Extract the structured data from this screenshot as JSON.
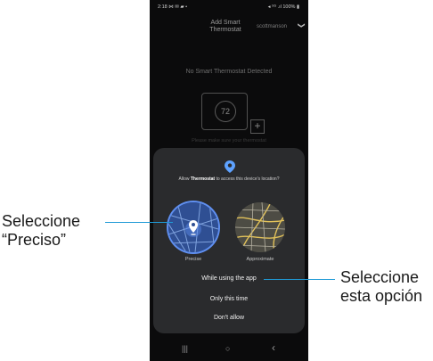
{
  "status_bar": {
    "time": "2:18 ⋈ ✉ ▰ •",
    "right": "◂ ⁵ᴳ .ıl 100% ▮"
  },
  "header": {
    "title": "Add Smart Thermostat",
    "user": "scottmanson",
    "chevron": "❯"
  },
  "main": {
    "no_detect_text": "No Smart Thermostat Detected",
    "thermostat_temp": "72",
    "plus": "+",
    "hint_text": "Please make sure your thermostat"
  },
  "dialog": {
    "prompt_prefix": "Allow ",
    "prompt_app": "Thermostat",
    "prompt_suffix": " to access this device's location?",
    "precise_label": "Precise",
    "approximate_label": "Approximate",
    "options": [
      "While using the app",
      "Only this time",
      "Don't allow"
    ]
  },
  "nav_bar": {
    "recents": "|||",
    "home": "○",
    "back": "‹"
  },
  "callouts": {
    "left_line1": "Seleccione",
    "left_line2": "“Preciso”",
    "right_line1": "Seleccione",
    "right_line2": "esta opción"
  },
  "colors": {
    "accent": "#1f9ad6",
    "dialog_bg": "#2a2b2d",
    "phone_bg": "#0b0b0c",
    "precise_ring": "#5f8ff0"
  },
  "icons": [
    "location-pin-icon",
    "precise-map-icon",
    "approximate-map-icon",
    "plus-icon",
    "chevron-down-icon"
  ]
}
